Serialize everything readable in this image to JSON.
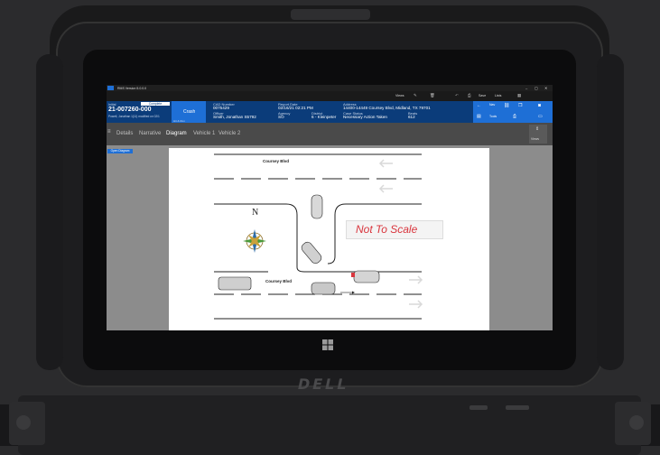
{
  "window": {
    "title": "RMS Version 5.0.0.0"
  },
  "toolbar": {
    "views_label": "Views",
    "save_label": "Save",
    "lists_label": "Lists"
  },
  "incident": {
    "status": "Initial",
    "badge": "Complete",
    "number": "21-007260-000",
    "officer_line": "Powell, Jonathan 1(11) modified on 02/1",
    "type_button": "Crash",
    "type_sub": "Hit & Run"
  },
  "fields": {
    "cad_number_label": "CAD Number",
    "cad_number": "0075429",
    "report_date_label": "Report Date",
    "report_date": "02/16/21 02:21 PM",
    "address_label": "Address",
    "address": "14400-14449 Coursey Blvd, Midland, TX 79701",
    "officer_label": "Officer",
    "officer": "Smith, Jonathan S5792",
    "agency_label": "Agency",
    "agency": "SO",
    "district_label": "District",
    "district": "6 - Kleinpeter",
    "case_status_label": "Case Status",
    "case_status": "Necessary Action Taken",
    "beats_label": "Beats",
    "beats": "612"
  },
  "actions": {
    "nav_label": "Nav",
    "tools_label": "Tools",
    "views_label": "Views"
  },
  "tabs": [
    "Details",
    "Narrative",
    "Diagram",
    "Vehicle 1",
    "Vehicle 2"
  ],
  "active_tab": "Diagram",
  "workarea": {
    "open_diagram_label": "Open Diagram"
  },
  "diagram": {
    "street_label_top": "Coursey Blvd",
    "street_label_bottom": "Coursey Blvd",
    "scale_note": "Not To Scale",
    "north_label": "N"
  },
  "device": {
    "brand": "DELL"
  },
  "colors": {
    "header_blue": "#0b3c7a",
    "accent_blue": "#1e6fd6",
    "scale_red": "#d9363e"
  }
}
